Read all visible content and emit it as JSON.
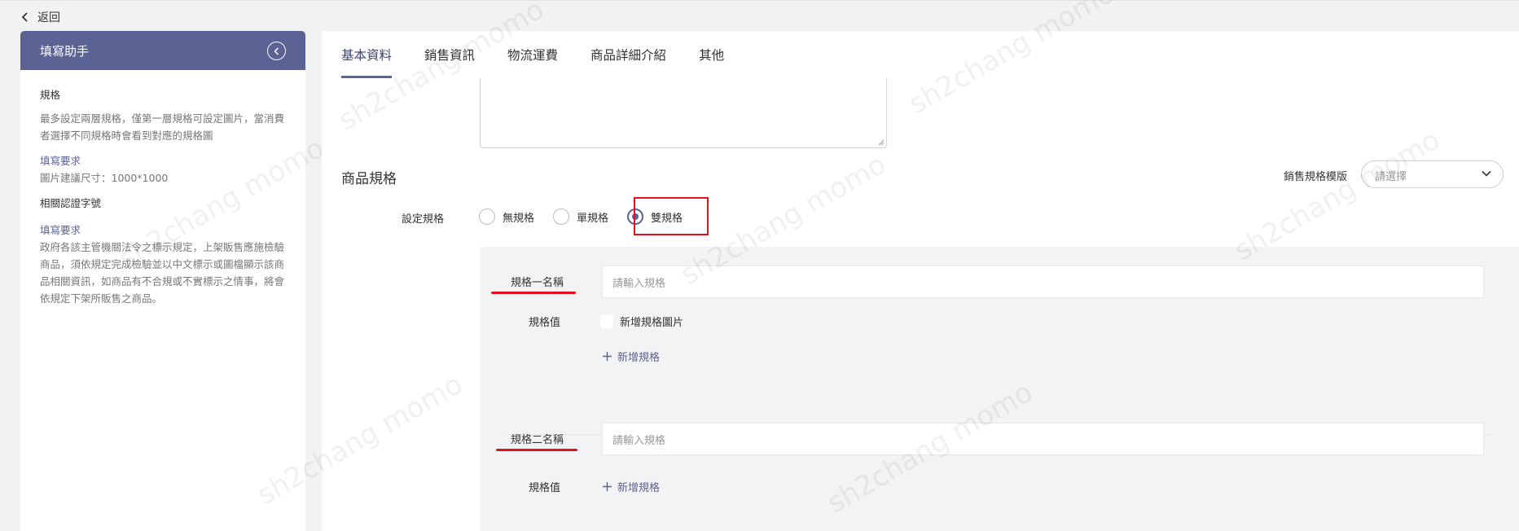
{
  "topbar": {
    "back_label": "返回"
  },
  "helper": {
    "title": "填寫助手",
    "sections": [
      {
        "title": "規格",
        "text": "最多設定兩層規格，僅第一層規格可設定圖片，當消費者選擇不同規格時會看到對應的規格圖"
      },
      {
        "sub": "填寫要求",
        "text": "圖片建議尺寸：1000*1000"
      },
      {
        "title": "相關認證字號"
      },
      {
        "sub": "填寫要求",
        "text": "政府各該主管機關法令之標示規定，上架販售應施檢驗商品，須依規定完成檢驗並以中文標示或圖檔顯示該商品相關資訊，如商品有不合規或不實標示之情事，將會依規定下架所販售之商品。"
      }
    ]
  },
  "tabs": [
    "基本資料",
    "銷售資訊",
    "物流運費",
    "商品詳細介紹",
    "其他"
  ],
  "spec": {
    "section_title": "商品規格",
    "template_label": "銷售規格模版",
    "template_placeholder": "請選擇",
    "set_label": "設定規格",
    "options": [
      "無規格",
      "單規格",
      "雙規格"
    ],
    "selected": "雙規格",
    "spec1": {
      "name_label": "規格一名稱",
      "placeholder": "請輸入規格",
      "value_label": "規格值",
      "add_image_label": "新增規格圖片",
      "add_label": "新增規格"
    },
    "spec2": {
      "name_label": "規格二名稱",
      "placeholder": "請輸入規格",
      "value_label": "規格值",
      "add_label": "新增規格"
    }
  },
  "watermark": "sh2chang momo",
  "colors": {
    "accent": "#5b6395",
    "highlight": "#e3101e",
    "panel_bg": "#f2f3f5"
  }
}
